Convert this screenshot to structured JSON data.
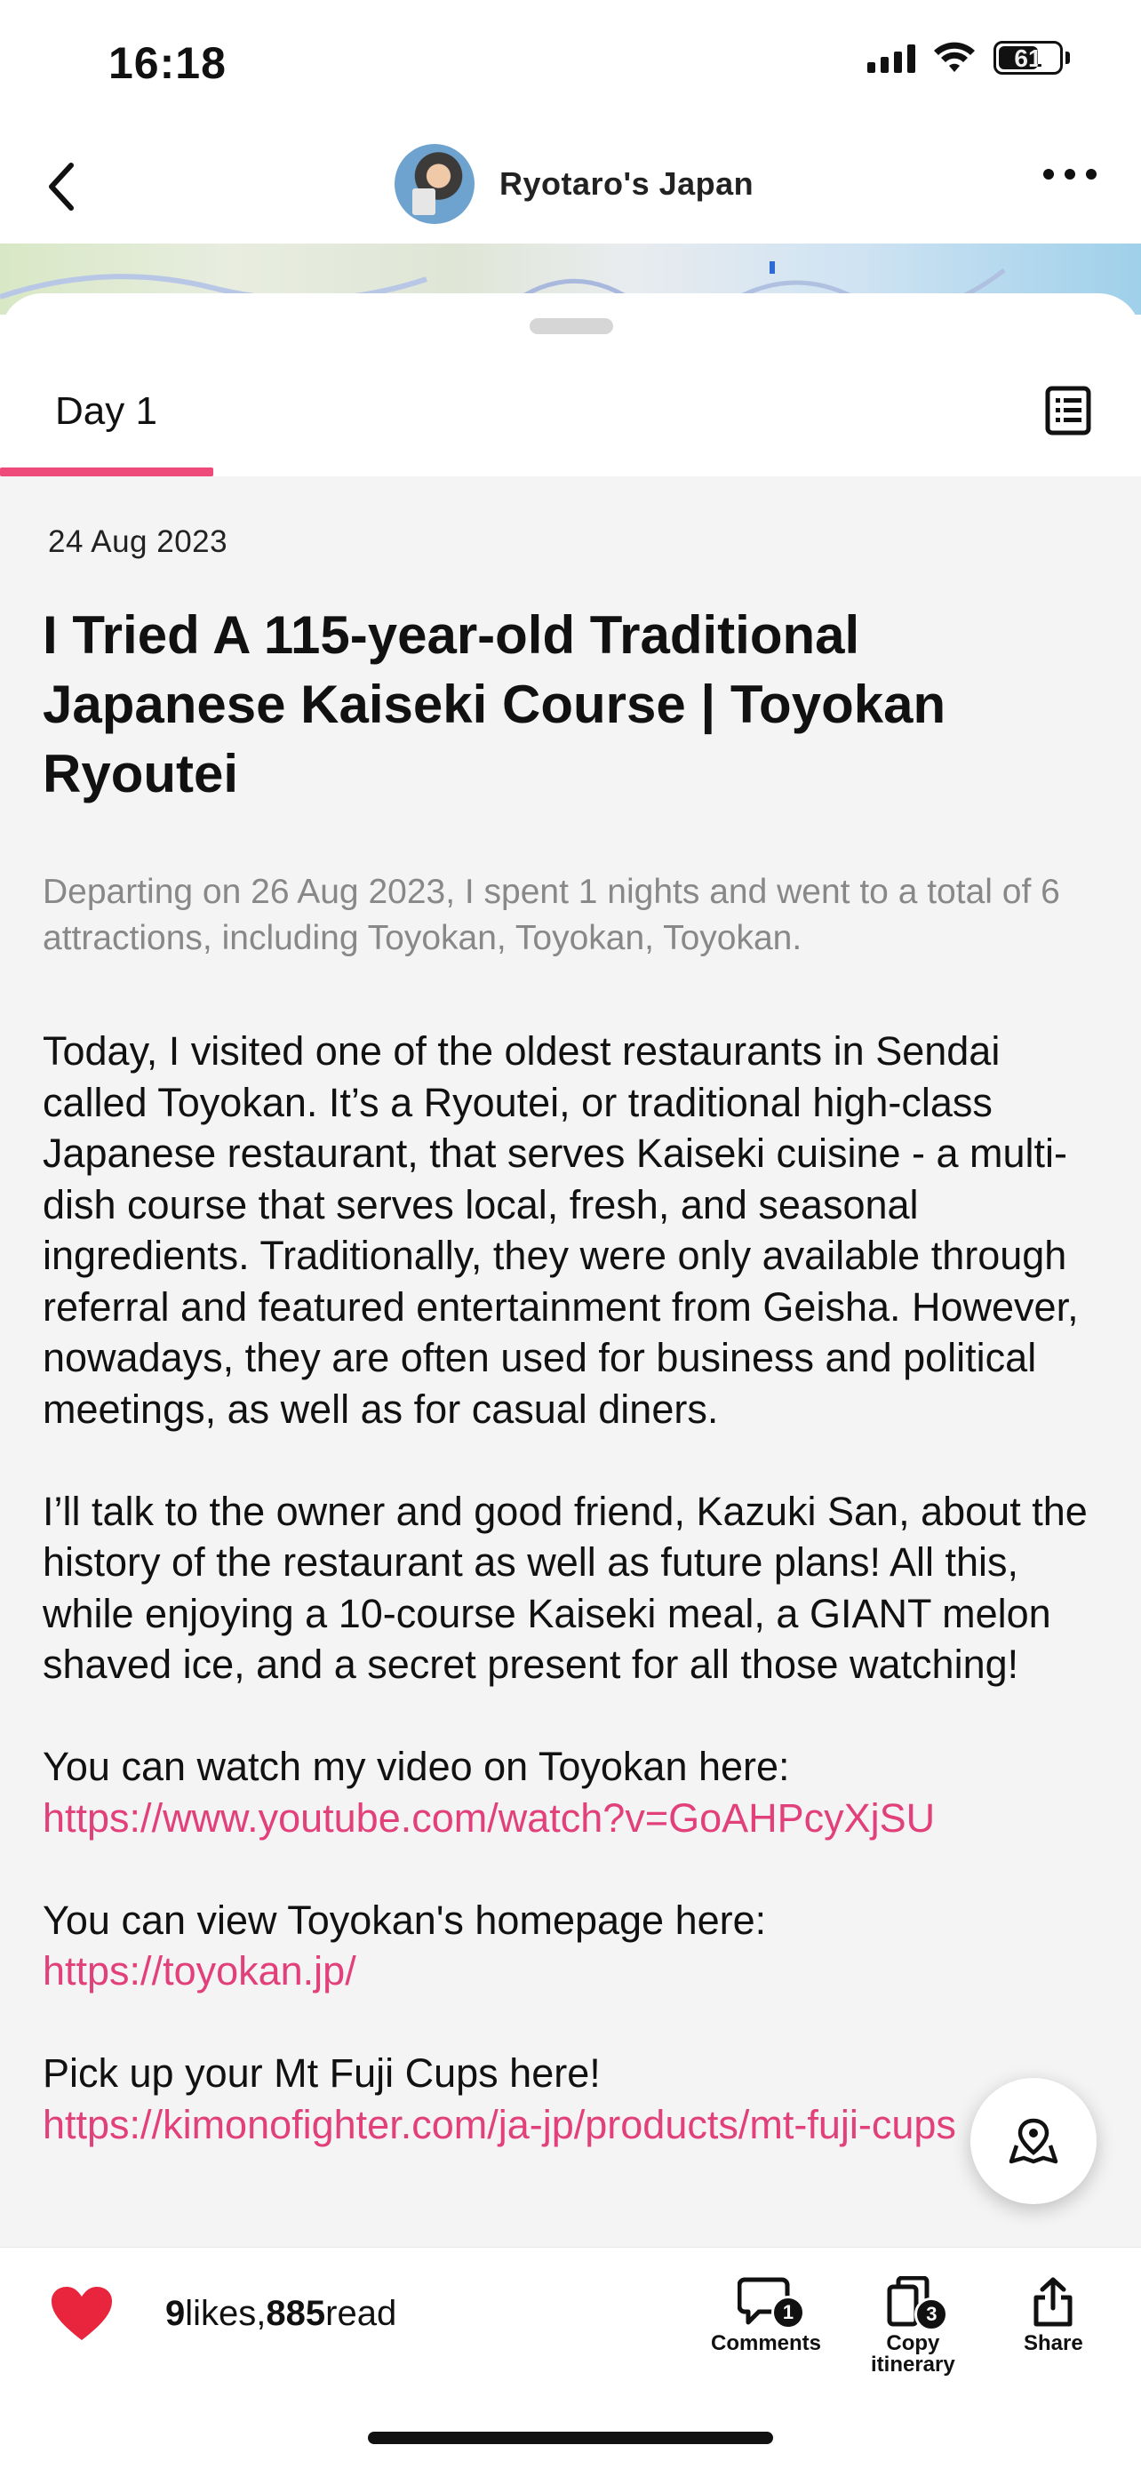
{
  "status_bar": {
    "time": "16:18",
    "battery": "61"
  },
  "header": {
    "author_name": "Ryotaro's Japan"
  },
  "tabs": {
    "active_label": "Day 1"
  },
  "post": {
    "date": "24 Aug 2023",
    "title": "I Tried A 115-year-old Traditional Japanese Kaiseki Course | Toyokan Ryoutei",
    "summary": "Departing on 26 Aug 2023, I spent 1 nights and went to a total of 6 attractions, including Toyokan, Toyokan, Toyokan.",
    "paragraphs": [
      "Today, I visited one of the oldest restaurants in Sendai called Toyokan. It’s a Ryoutei, or traditional high-class Japanese restaurant, that serves Kaiseki cuisine - a multi-dish course that serves local, fresh, and seasonal ingredients. Traditionally, they were only available through referral and featured entertainment from Geisha. However, nowadays, they are often used for business and political meetings, as well as for casual diners.",
      "I’ll talk to the owner and good friend, Kazuki San, about the history of the restaurant as well as future plans! All this, while enjoying a 10-course Kaiseki meal, a GIANT melon shaved ice, and a secret present for all those watching!"
    ],
    "link_blocks": [
      {
        "text": "You can watch my video on Toyokan here:",
        "url": "https://www.youtube.com/watch?v=GoAHPcyXjSU"
      },
      {
        "text": "You can view Toyokan's homepage here:",
        "url": "https://toyokan.jp/"
      },
      {
        "text": "Pick up your Mt Fuji Cups here!",
        "url": "https://kimonofighter.com/ja-jp/products/mt-fuji-cups"
      }
    ]
  },
  "bottom_bar": {
    "likes_count": "9",
    "likes_word": "likes,",
    "reads_count": "885",
    "reads_word": "read",
    "comments_label": "Comments",
    "comments_badge": "1",
    "copy_label_line1": "Copy",
    "copy_label_line2": "itinerary",
    "copy_badge": "3",
    "share_label": "Share"
  },
  "colors": {
    "accent": "#ef4b7a",
    "link": "#e2407a",
    "like": "#e8253c"
  },
  "icons": [
    "back-chevron-icon",
    "more-icon",
    "list-icon",
    "map-pin-icon",
    "heart-icon",
    "comment-icon",
    "copy-icon",
    "share-icon"
  ]
}
